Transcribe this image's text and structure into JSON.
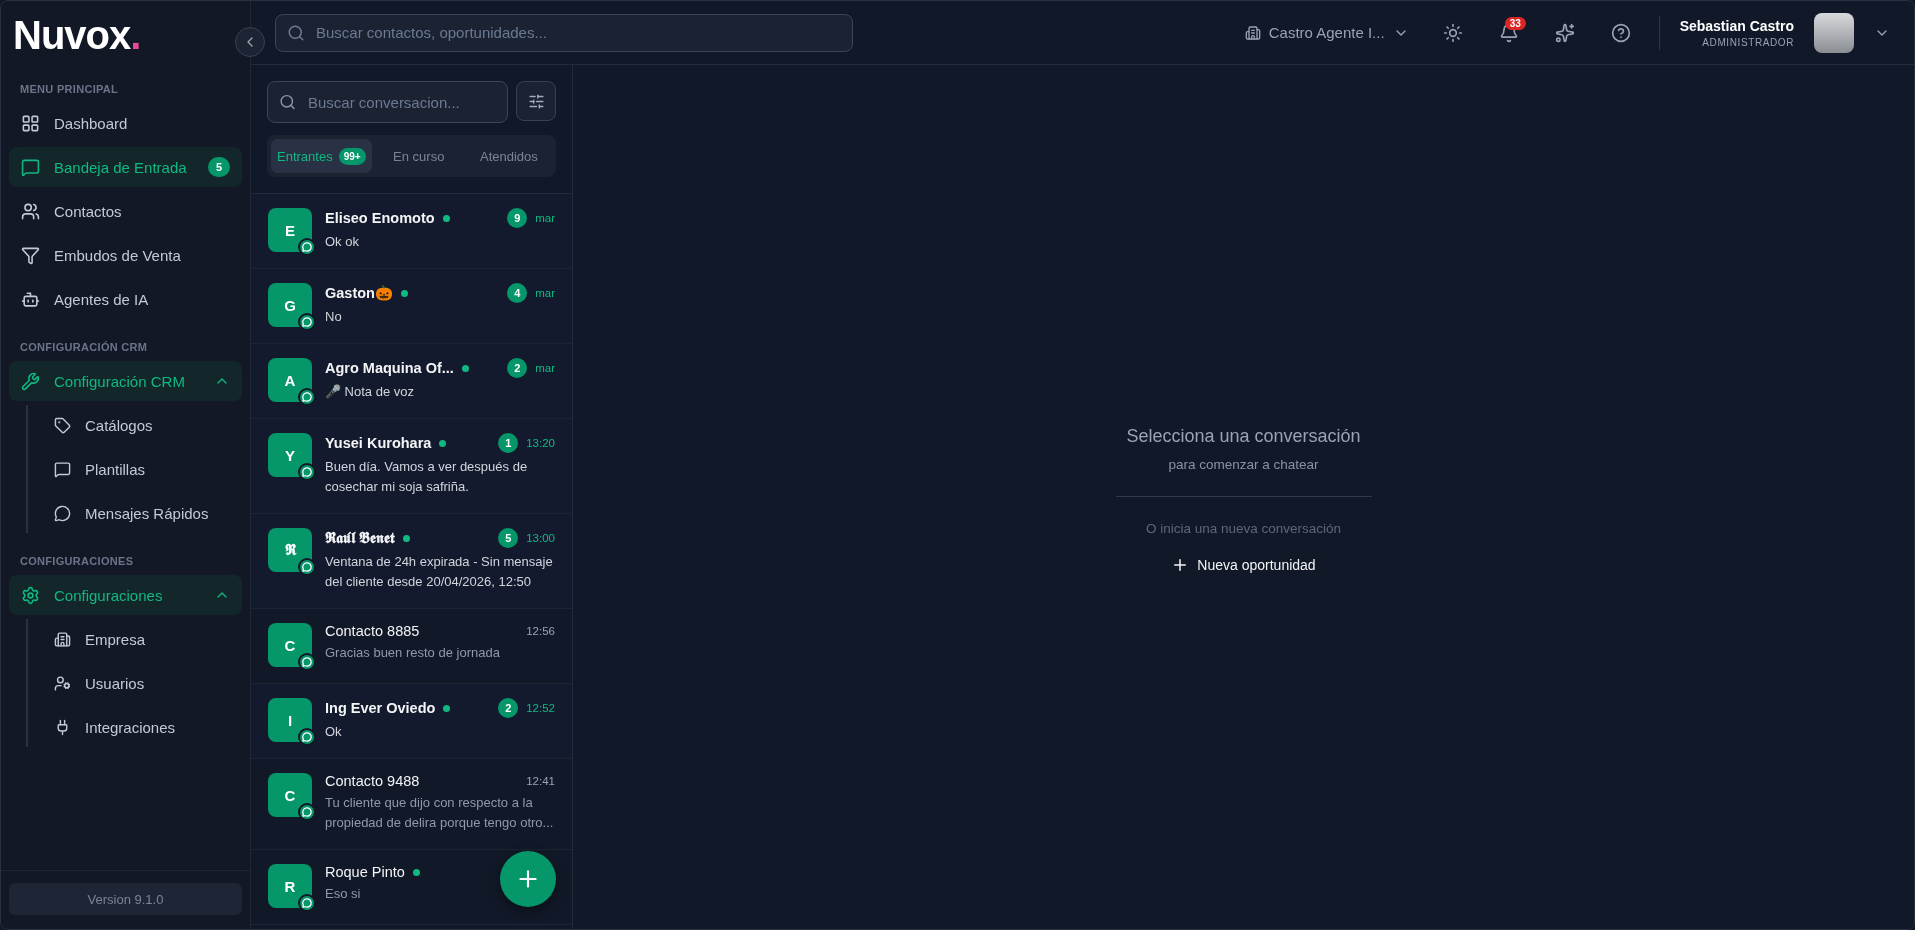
{
  "logo": {
    "text": "Nuvox",
    "dot": "."
  },
  "sidebar": {
    "sections": [
      {
        "title": "MENU PRINCIPAL",
        "items": [
          {
            "kind": "link",
            "label": "Dashboard",
            "selected": false
          },
          {
            "kind": "link",
            "label": "Bandeja de Entrada",
            "selected": true,
            "badge": "5"
          },
          {
            "kind": "link",
            "label": "Contactos",
            "selected": false
          },
          {
            "kind": "link",
            "label": "Embudos de Venta",
            "selected": false
          },
          {
            "kind": "link",
            "label": "Agentes de IA",
            "selected": false
          }
        ]
      },
      {
        "title": "CONFIGURACIÓN CRM",
        "items": [
          {
            "kind": "group",
            "label": "Configuración CRM",
            "selected": true,
            "expanded": true,
            "children": [
              {
                "label": "Catálogos"
              },
              {
                "label": "Plantillas"
              },
              {
                "label": "Mensajes Rápidos"
              }
            ]
          }
        ]
      },
      {
        "title": "CONFIGURACIONES",
        "items": [
          {
            "kind": "group",
            "label": "Configuraciones",
            "selected": true,
            "expanded": true,
            "children": [
              {
                "label": "Empresa"
              },
              {
                "label": "Usuarios"
              },
              {
                "label": "Integraciones"
              }
            ]
          }
        ]
      }
    ],
    "version": "Version 9.1.0"
  },
  "topbar": {
    "search": {
      "placeholder": "Buscar contactos, oportunidades..."
    },
    "workspace": "Castro Agente I...",
    "notifications": "33",
    "user": {
      "name": "Sebastian Castro",
      "role": "ADMINISTRADOR"
    }
  },
  "inbox": {
    "search": {
      "placeholder": "Buscar conversacion..."
    },
    "tabs": [
      {
        "label": "Entrantes",
        "badge": "99+",
        "selected": true
      },
      {
        "label": "En curso",
        "selected": false
      },
      {
        "label": "Atendidos",
        "selected": false
      }
    ],
    "conversations": [
      {
        "initial": "E",
        "name": "Eliseo Enomoto",
        "online": true,
        "unread": "9",
        "time": "mar",
        "preview": "Ok ok"
      },
      {
        "initial": "G",
        "name": "Gaston🎃",
        "online": true,
        "unread": "4",
        "time": "mar",
        "preview": "No"
      },
      {
        "initial": "A",
        "name": "Agro Maquina Of...",
        "online": true,
        "unread": "2",
        "time": "mar",
        "preview": "🎤 Nota de voz"
      },
      {
        "initial": "Y",
        "name": "Yusei Kurohara",
        "online": true,
        "unread": "1",
        "time": "13:20",
        "preview": "Buen día. Vamos a ver después de cosechar mi soja safriña."
      },
      {
        "initial": "𝕽",
        "name": "𝕽𝖆𝖚́𝖑 𝕭𝖊𝖓𝖊𝖙",
        "online": true,
        "unread": "5",
        "time": "13:00",
        "preview": "Ventana de 24h expirada - Sin mensaje del cliente desde 20/04/2026, 12:50"
      },
      {
        "initial": "C",
        "name": "Contacto 8885",
        "online": false,
        "time": "12:56",
        "preview": "Gracias buen resto de jornada"
      },
      {
        "initial": "I",
        "name": "Ing Ever Oviedo",
        "online": true,
        "unread": "2",
        "time": "12:52",
        "preview": "Ok"
      },
      {
        "initial": "C",
        "name": "Contacto 9488",
        "online": false,
        "time": "12:41",
        "preview": "Tu cliente que dijo con respecto a la propiedad de delira porque tengo otro..."
      },
      {
        "initial": "R",
        "name": "Roque Pinto",
        "online": true,
        "preview": "Eso si"
      }
    ]
  },
  "empty_state": {
    "title": "Selecciona una conversación",
    "subtitle": "para comenzar a chatear",
    "hint": "O inicia una nueva conversación",
    "action": "Nueva oportunidad"
  }
}
